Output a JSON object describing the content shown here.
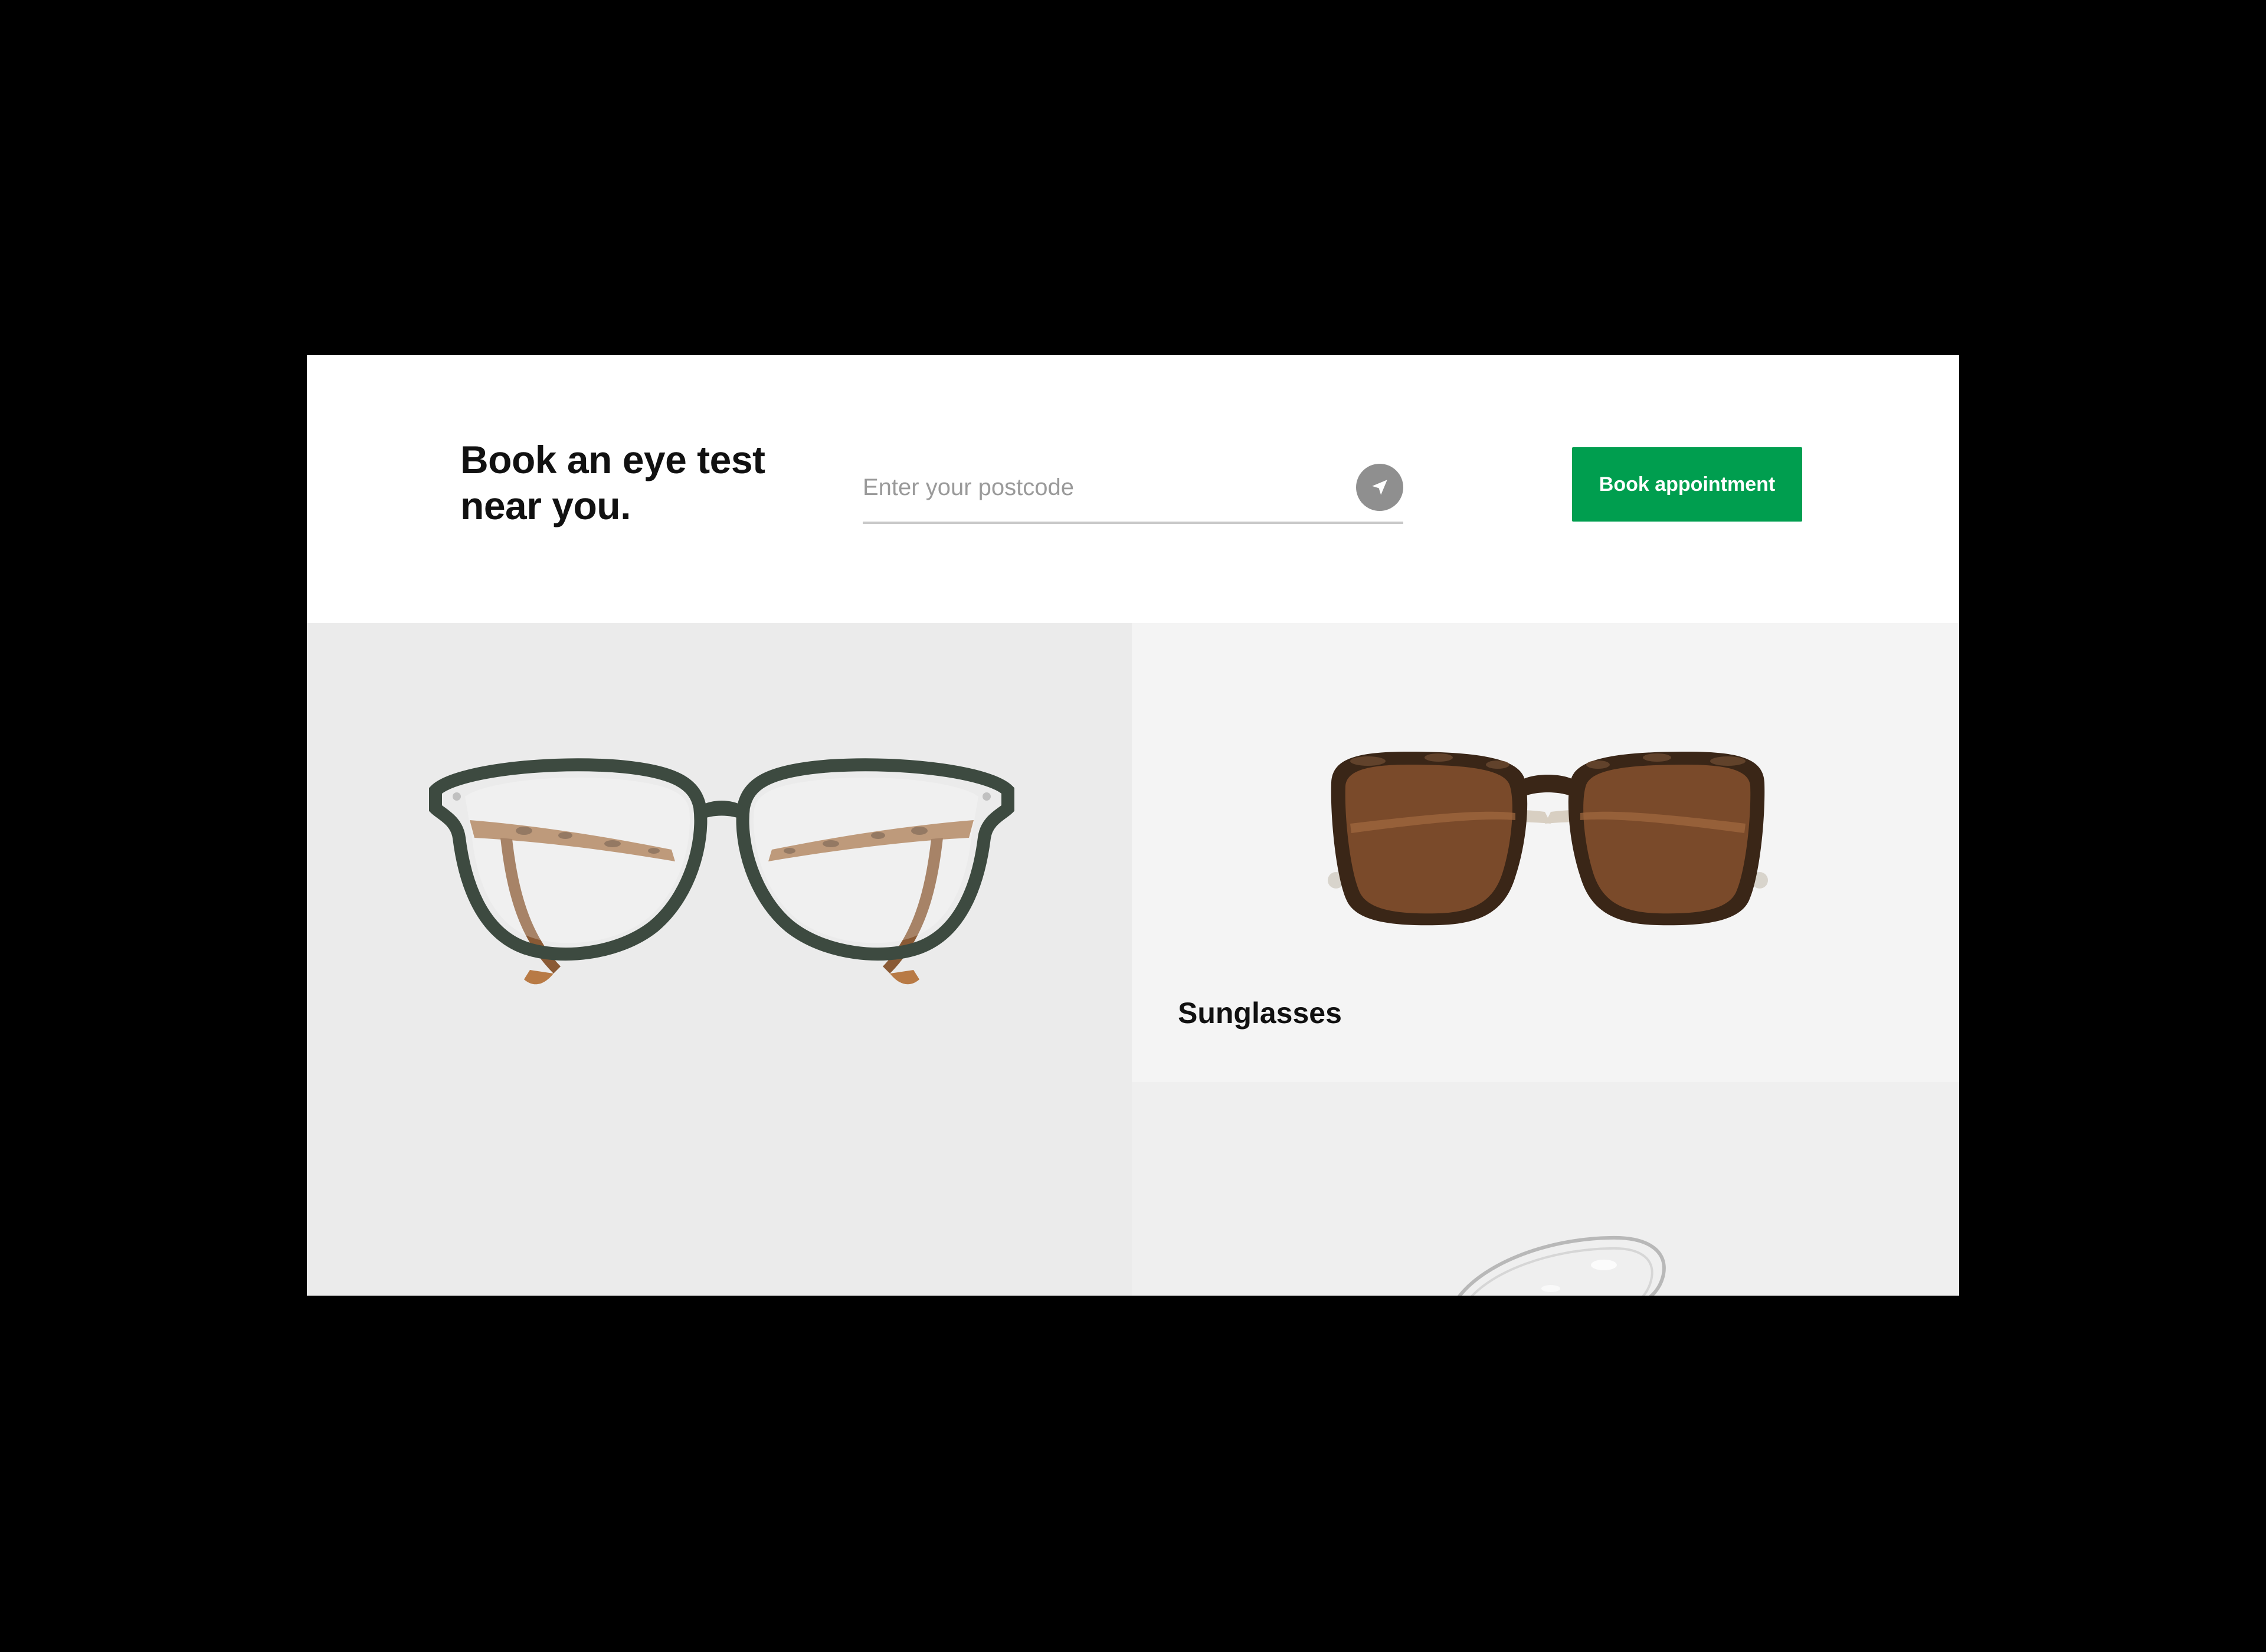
{
  "booking": {
    "title_line1": "Book an eye test",
    "title_line2": "near you.",
    "postcode_placeholder": "Enter your postcode",
    "postcode_value": "",
    "locate_icon": "location-arrow-icon",
    "cta_label": "Book appointment"
  },
  "tiles": [
    {
      "label": "",
      "image": "green-cat-eye-glasses"
    },
    {
      "label": "Sunglasses",
      "image": "tortoiseshell-sunglasses"
    },
    {
      "label": "",
      "image": "contact-lens"
    }
  ],
  "colors": {
    "page_background": "#000000",
    "cta_green": "#009e4f",
    "locate_button_grey": "#8f8f8f",
    "tile_grey": "#ebebeb",
    "tile_light_grey": "#f4f4f4"
  }
}
